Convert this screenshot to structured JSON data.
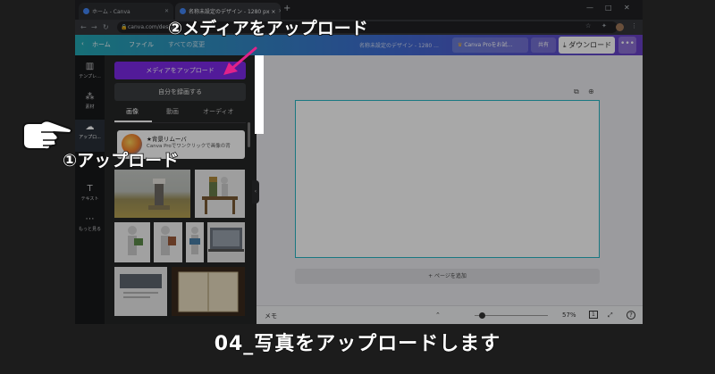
{
  "browser": {
    "tabs": [
      {
        "label": "ホーム - Canva"
      },
      {
        "label": "名称未設定のデザイン - 1280 px ×"
      }
    ],
    "new_tab": "+",
    "url": "canva.com/design/",
    "window_controls": [
      "—",
      "□",
      "✕"
    ]
  },
  "canva_header": {
    "home": "ホーム",
    "file": "ファイル",
    "saved": "すべての変更",
    "design_name": "名称未設定のデザイン - 1280 ...",
    "pro_button": "Canva Proをお試...",
    "share_button": "共有",
    "download_button": "ダウンロード",
    "more_button": "•••"
  },
  "rail": {
    "items": [
      {
        "label": "テンプレ...",
        "icon": "template-icon"
      },
      {
        "label": "素材",
        "icon": "elements-icon"
      },
      {
        "label": "アップロ...",
        "icon": "upload-icon"
      },
      {
        "label": "テキスト",
        "icon": "text-icon"
      },
      {
        "label": "もっと見る",
        "icon": "more-icon"
      }
    ]
  },
  "panel": {
    "upload_button": "メディアをアップロード",
    "record_button": "自分を録画する",
    "tabs": [
      "画像",
      "動画",
      "オーディオ"
    ],
    "promo_title": "★背景リムーバ",
    "promo_desc": "Canva Proでワンクリックで画像の背"
  },
  "editor": {
    "add_page": "+ ページを追加",
    "notes": "メモ",
    "zoom": "57%",
    "page_count": "1",
    "help": "?"
  },
  "annotations": {
    "step2": "②メディアをアップロード",
    "step1": "①アップロード",
    "caption": "04_写真をアップロードします"
  },
  "colors": {
    "accent_purple": "#7d2ae8",
    "header_gradient_start": "#23a8b4",
    "header_gradient_end": "#6a40c7",
    "canvas_border": "#26b6c4",
    "arrow_magenta": "#e0228a"
  }
}
